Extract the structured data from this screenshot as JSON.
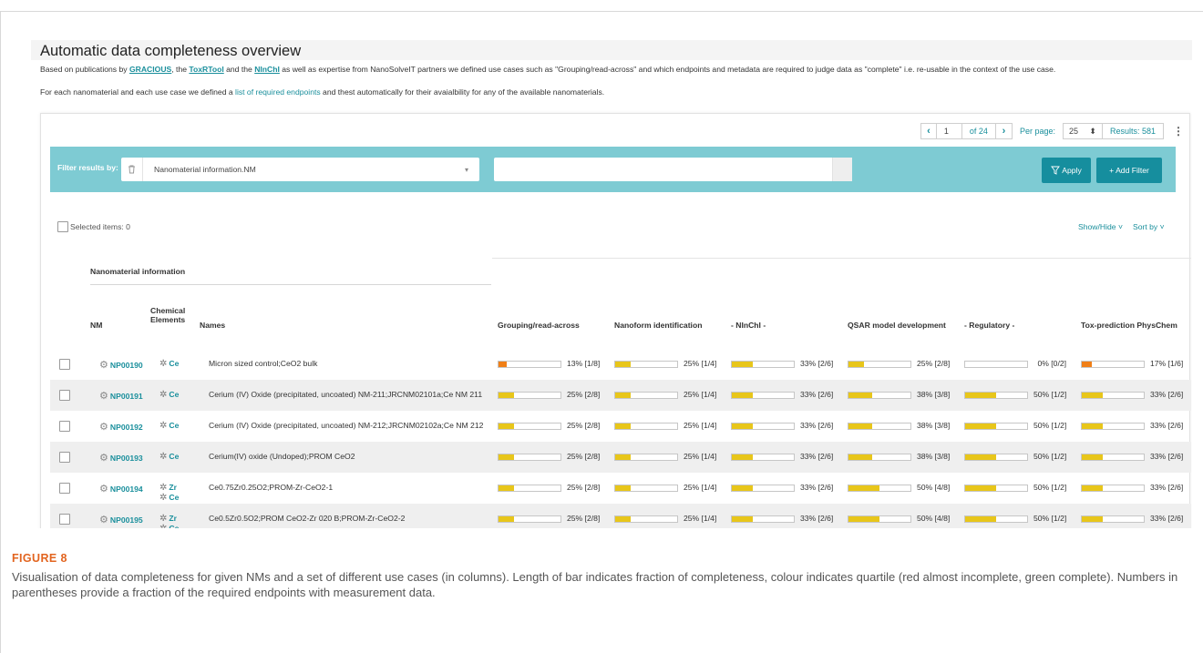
{
  "figure": {
    "label": "FIGURE 8",
    "caption": "Visualisation of data completeness for given NMs and a set of different use cases (in columns). Length of bar indicates fraction of completeness, colour indicates quartile (red almost incomplete, green complete). Numbers in parentheses provide a fraction of the required endpoints with measurement data."
  },
  "app": {
    "title": "Automatic data completeness overview",
    "intro1": {
      "pre": "Based on publications by ",
      "link1": "GRACIOUS",
      "mid1": ", the ",
      "link2": "ToxRTool",
      "mid2": " and the ",
      "link3": "NInChI",
      "post": " as well as expertise from NanoSolveIT partners we defined use cases such as \"Grouping/read-across\" and which endpoints and metadata are required to judge data as \"complete\" i.e. re-usable in the context of the use case."
    },
    "intro2": {
      "pre": "For each nanomaterial and each use case we defined a ",
      "link": "list of required endpoints",
      "post": " and thest automatically for their avaialbility for any of the available nanomaterials."
    }
  },
  "pager": {
    "prev": "‹",
    "page": "1",
    "of": "of 24",
    "next": "›",
    "per_page_label": "Per page:",
    "per_page": "25",
    "per_page_caret": "⬍",
    "results": "Results: 581",
    "kebab": "⋮"
  },
  "filter": {
    "label": "Filter results by:",
    "field": "Nanomaterial information.NM",
    "value": "",
    "apply": "Apply",
    "add_filter": "+ Add Filter",
    "colors": {
      "bar": "#7ecbd3",
      "button": "#168e9e"
    }
  },
  "selection": {
    "selected": "Selected items: 0",
    "show_hide": "Show/Hide",
    "sort_by": "Sort by"
  },
  "table": {
    "group_header": "Nanomaterial information",
    "headers": {
      "nm": "NM",
      "elements_1": "Chemical",
      "elements_2": "Elements",
      "names": "Names",
      "uc": [
        "Grouping/read-across",
        "Nanoform identification",
        "- NInChI -",
        "QSAR model development",
        "- Regulatory -",
        "Tox-prediction PhysChem"
      ]
    },
    "bar_colors": {
      "red": "#f07f17",
      "yellow": "#e8c61a"
    },
    "rows": [
      {
        "nm": "NP00190",
        "elements": [
          "Ce"
        ],
        "names": "Micron sized control;CeO2 bulk",
        "values": [
          {
            "label": "13% [1/8]",
            "fraction": 0.125,
            "color": "red"
          },
          {
            "label": "25% [1/4]",
            "fraction": 0.25,
            "color": "yellow"
          },
          {
            "label": "33% [2/6]",
            "fraction": 0.333,
            "color": "yellow"
          },
          {
            "label": "25% [2/8]",
            "fraction": 0.25,
            "color": "yellow"
          },
          {
            "label": "0% [0/2]",
            "fraction": 0.0,
            "color": "yellow"
          },
          {
            "label": "17% [1/6]",
            "fraction": 0.167,
            "color": "red"
          }
        ]
      },
      {
        "nm": "NP00191",
        "elements": [
          "Ce"
        ],
        "names": "Cerium (IV) Oxide (precipitated, uncoated) NM-211;JRCNM02101a;Ce NM 211",
        "values": [
          {
            "label": "25% [2/8]",
            "fraction": 0.25,
            "color": "yellow"
          },
          {
            "label": "25% [1/4]",
            "fraction": 0.25,
            "color": "yellow"
          },
          {
            "label": "33% [2/6]",
            "fraction": 0.333,
            "color": "yellow"
          },
          {
            "label": "38% [3/8]",
            "fraction": 0.375,
            "color": "yellow"
          },
          {
            "label": "50% [1/2]",
            "fraction": 0.5,
            "color": "yellow"
          },
          {
            "label": "33% [2/6]",
            "fraction": 0.333,
            "color": "yellow"
          }
        ]
      },
      {
        "nm": "NP00192",
        "elements": [
          "Ce"
        ],
        "names": "Cerium (IV) Oxide (precipitated, uncoated) NM-212;JRCNM02102a;Ce NM 212",
        "values": [
          {
            "label": "25% [2/8]",
            "fraction": 0.25,
            "color": "yellow"
          },
          {
            "label": "25% [1/4]",
            "fraction": 0.25,
            "color": "yellow"
          },
          {
            "label": "33% [2/6]",
            "fraction": 0.333,
            "color": "yellow"
          },
          {
            "label": "38% [3/8]",
            "fraction": 0.375,
            "color": "yellow"
          },
          {
            "label": "50% [1/2]",
            "fraction": 0.5,
            "color": "yellow"
          },
          {
            "label": "33% [2/6]",
            "fraction": 0.333,
            "color": "yellow"
          }
        ]
      },
      {
        "nm": "NP00193",
        "elements": [
          "Ce"
        ],
        "names": "Cerium(IV) oxide (Undoped);PROM CeO2",
        "values": [
          {
            "label": "25% [2/8]",
            "fraction": 0.25,
            "color": "yellow"
          },
          {
            "label": "25% [1/4]",
            "fraction": 0.25,
            "color": "yellow"
          },
          {
            "label": "33% [2/6]",
            "fraction": 0.333,
            "color": "yellow"
          },
          {
            "label": "38% [3/8]",
            "fraction": 0.375,
            "color": "yellow"
          },
          {
            "label": "50% [1/2]",
            "fraction": 0.5,
            "color": "yellow"
          },
          {
            "label": "33% [2/6]",
            "fraction": 0.333,
            "color": "yellow"
          }
        ]
      },
      {
        "nm": "NP00194",
        "elements": [
          "Zr",
          "Ce"
        ],
        "names": "Ce0.75Zr0.25O2;PROM-Zr-CeO2-1",
        "values": [
          {
            "label": "25% [2/8]",
            "fraction": 0.25,
            "color": "yellow"
          },
          {
            "label": "25% [1/4]",
            "fraction": 0.25,
            "color": "yellow"
          },
          {
            "label": "33% [2/6]",
            "fraction": 0.333,
            "color": "yellow"
          },
          {
            "label": "50% [4/8]",
            "fraction": 0.5,
            "color": "yellow"
          },
          {
            "label": "50% [1/2]",
            "fraction": 0.5,
            "color": "yellow"
          },
          {
            "label": "33% [2/6]",
            "fraction": 0.333,
            "color": "yellow"
          }
        ]
      },
      {
        "nm": "NP00195",
        "elements": [
          "Zr",
          "Ce"
        ],
        "names": "Ce0.5Zr0.5O2;PROM CeO2-Zr 020 B;PROM-Zr-CeO2-2",
        "values": [
          {
            "label": "25% [2/8]",
            "fraction": 0.25,
            "color": "yellow"
          },
          {
            "label": "25% [1/4]",
            "fraction": 0.25,
            "color": "yellow"
          },
          {
            "label": "33% [2/6]",
            "fraction": 0.333,
            "color": "yellow"
          },
          {
            "label": "50% [4/8]",
            "fraction": 0.5,
            "color": "yellow"
          },
          {
            "label": "50% [1/2]",
            "fraction": 0.5,
            "color": "yellow"
          },
          {
            "label": "33% [2/6]",
            "fraction": 0.333,
            "color": "yellow"
          }
        ]
      }
    ]
  }
}
